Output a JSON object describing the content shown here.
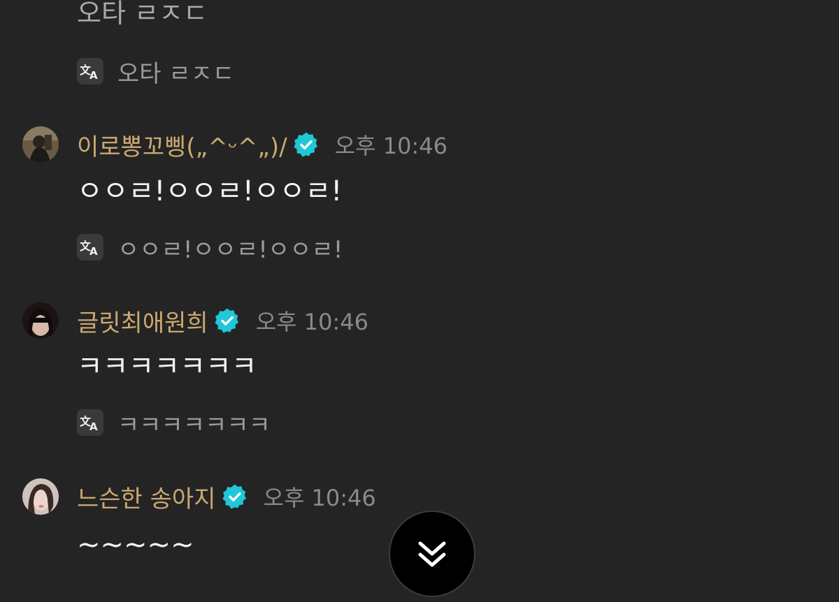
{
  "previous_message": {
    "text": "오타 ㄹㅈㄷ",
    "translation": "오타 ㄹㅈㄷ"
  },
  "messages": [
    {
      "username": "이로뽕꼬삥(„^ᵕ^„)/",
      "time": "오후 10:46",
      "text": "ㅇㅇㄹ!ㅇㅇㄹ!ㅇㅇㄹ!",
      "translation": "ㅇㅇㄹ!ㅇㅇㄹ!ㅇㅇㄹ!"
    },
    {
      "username": "글릿최애원희",
      "time": "오후 10:46",
      "text": "ㅋㅋㅋㅋㅋㅋㅋ",
      "translation": "ㅋㅋㅋㅋㅋㅋㅋ"
    },
    {
      "username": "느슨한 송아지",
      "time": "오후 10:46",
      "text": "~~~~~"
    }
  ],
  "colors": {
    "background": "#242424",
    "username": "#cba871",
    "verified_badge": "#1fc7d8",
    "timestamp": "#8a8a8a",
    "message_text": "#f2f2f2",
    "translation_text": "#9a9a9a"
  },
  "icons": {
    "translate": "translate-icon",
    "verified": "verified-badge-icon",
    "scroll_down": "double-chevron-down-icon"
  }
}
